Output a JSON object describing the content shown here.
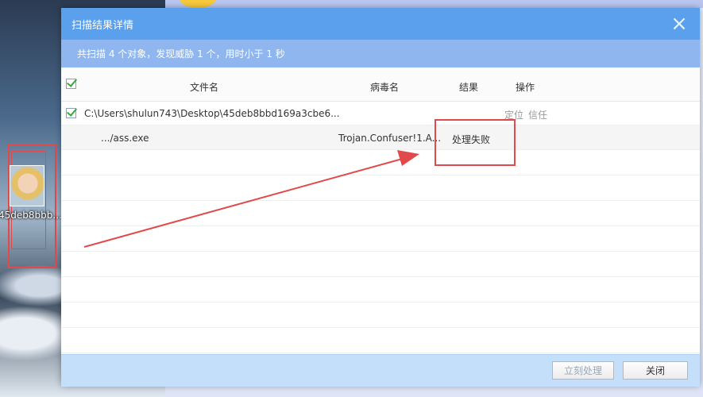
{
  "desktop": {
    "file_icon_label": "45deb8bbb..."
  },
  "dialog": {
    "title": "扫描结果详情",
    "close_glyph": "×",
    "summary": "共扫描 4 个对象，发现威胁 1 个，用时小于 1 秒",
    "columns": {
      "filename": "文件名",
      "virus": "病毒名",
      "result": "结果",
      "action": "操作"
    },
    "rows": [
      {
        "path": "C:\\Users\\shulun743\\Desktop\\45deb8bbd169a3cbe6...",
        "action_locate": "定位",
        "action_trust": "信任"
      },
      {
        "filename": ".../ass.exe",
        "virus": "Trojan.Confuser!1.A...",
        "result": "处理失败"
      }
    ],
    "buttons": {
      "process_now": "立刻处理",
      "close": "关闭"
    }
  },
  "colors": {
    "titlebar": "#5aa0ec",
    "summary_bar": "#8fb6ee",
    "highlight_annotation": "#e04a4a",
    "check_green": "#37a93d"
  }
}
